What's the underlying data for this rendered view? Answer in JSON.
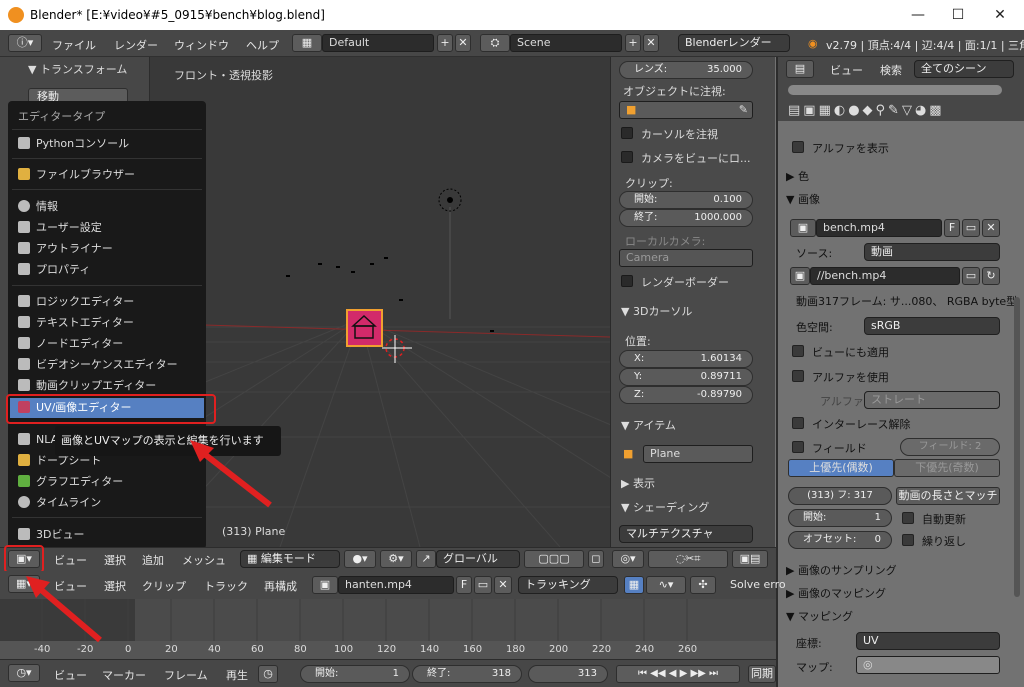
{
  "window": {
    "title": "Blender* [E:¥video¥#5_0915¥bench¥blog.blend]"
  },
  "topbar": {
    "menus": [
      "ファイル",
      "レンダー",
      "ウィンドウ",
      "ヘルプ"
    ],
    "layout": "Default",
    "scene": "Scene",
    "engine": "Blenderレンダー",
    "stats": "v2.79 | 頂点:4/4 | 辺:4/4 | 面:1/1 | 三角"
  },
  "viewport": {
    "label": "フロント・透視投影",
    "object": "(313) Plane"
  },
  "n_panel": {
    "lens_label": "レンズ:",
    "lens_value": "35.000",
    "lock_label": "オブジェクトに注視:",
    "lock_cursor": "カーソルを注視",
    "lock_camera": "カメラをビューにロ...",
    "clip_label": "クリップ:",
    "clip_start_label": "開始:",
    "clip_start": "0.100",
    "clip_end_label": "終了:",
    "clip_end": "1000.000",
    "local_camera": "ローカルカメラ:",
    "camera": "Camera",
    "render_border": "レンダーボーダー",
    "cursor_header": "3Dカーソル",
    "location": "位置:",
    "x_label": "X:",
    "x": "1.60134",
    "y_label": "Y:",
    "y": "0.89711",
    "z_label": "Z:",
    "z": "-0.89790",
    "item_header": "アイテム",
    "item_name": "Plane",
    "display_header": "表示",
    "shading_header": "シェーディング",
    "shading_mode": "マルチテクスチャ"
  },
  "properties": {
    "view": "ビュー",
    "search": "検索",
    "scene_filter": "全てのシーン",
    "show_alpha": "アルファを表示",
    "color_header": "色",
    "image_header": "画像",
    "image_name": "bench.mp4",
    "image_f": "F",
    "source_label": "ソース:",
    "source_value": "動画",
    "filepath": "//bench.mp4",
    "info": "動画317フレーム: サ...080、 RGBA byte型",
    "colorspace_label": "色空間:",
    "colorspace_value": "sRGB",
    "view_as_render": "ビューにも適用",
    "use_alpha": "アルファを使用",
    "alpha_label": "アルファ:",
    "alpha_value": "ストレート",
    "deinterlace": "インターレース解除",
    "fields": "フィールド",
    "fields_value": "フィールド: 2",
    "upper_first": "上優先(偶数)",
    "lower_first": "下優先(奇数)",
    "frames_value": "(313) フ: 317",
    "match_length": "動画の長さとマッチ",
    "start_label": "開始:",
    "start_value": "1",
    "auto_refresh": "自動更新",
    "offset_label": "オフセット:",
    "offset_value": "0",
    "cyclic": "繰り返し",
    "sampling_header": "画像のサンプリング",
    "mapping_header": "画像のマッピング",
    "mapping2_header": "マッピング",
    "coords_label": "座標:",
    "coords_value": "UV",
    "map_label": "マップ:"
  },
  "editor_menu": {
    "title": "エディタータイプ",
    "items": [
      "Pythonコンソール",
      "ファイルブラウザー",
      "情報",
      "ユーザー設定",
      "アウトライナー",
      "プロパティ",
      "ロジックエディター",
      "テキストエディター",
      "ノードエディター",
      "ビデオシーケンスエディター",
      "動画クリップエディター",
      "UV/画像エディター",
      "NLA",
      "ドープシート",
      "グラフエディター",
      "タイムライン",
      "3Dビュー"
    ]
  },
  "tooltip": {
    "text": "画像とUVマップの表示と編集を行います"
  },
  "view3d_header": {
    "menus": [
      "ビュー",
      "選択",
      "追加",
      "メッシュ"
    ],
    "mode": "編集モード",
    "orientation": "グローバル"
  },
  "clip_header": {
    "menus": [
      "ビュー",
      "選択",
      "クリップ",
      "トラック",
      "再構成"
    ],
    "clip_name": "hanten.mp4",
    "f": "F",
    "mode": "トラッキング",
    "solve": "Solve erro"
  },
  "timeline": {
    "ticks": [
      "-40",
      "-20",
      "0",
      "20",
      "40",
      "60",
      "80",
      "100",
      "120",
      "140",
      "160",
      "180",
      "200",
      "220",
      "240",
      "260"
    ],
    "menus": [
      "ビュー",
      "マーカー",
      "フレーム",
      "再生"
    ],
    "start_label": "開始:",
    "start": "1",
    "end_label": "終了:",
    "end": "318",
    "current": "313",
    "sync": "同期"
  },
  "left_panel": {
    "transform": "▼ トランスフォーム",
    "move": "移動"
  },
  "colors": {
    "highlight": "#e02020",
    "selected": "#5680c2",
    "accent": "#f09020"
  }
}
